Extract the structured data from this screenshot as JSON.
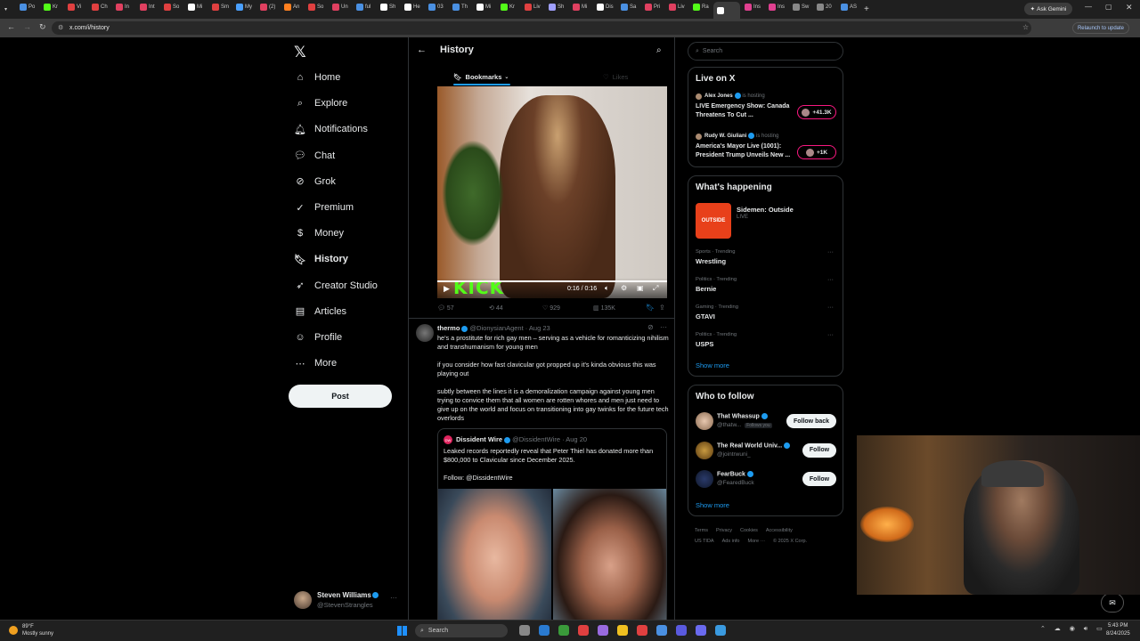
{
  "browser": {
    "tabs": [
      "Po",
      "Kr",
      "Vi",
      "Ch",
      "In",
      "Int",
      "So",
      "Mi",
      "Sm",
      "My",
      "(2)",
      "An",
      "So",
      "Un",
      "ful",
      "Sh",
      "He",
      "03",
      "Th",
      "Mi",
      "Kr",
      "Liv",
      "Sh",
      "Mi",
      "Dis",
      "Sa",
      "Pri",
      "Liv",
      "Ra",
      "",
      "Ins",
      "Ins",
      "Sw",
      "20",
      "AS"
    ],
    "url": "x.com/i/history",
    "ask_gemini": "Ask Gemini",
    "relaunch": "Relaunch to update"
  },
  "nav": {
    "items": [
      {
        "label": "Home",
        "icon": "home-icon"
      },
      {
        "label": "Explore",
        "icon": "search-icon"
      },
      {
        "label": "Notifications",
        "icon": "bell-icon"
      },
      {
        "label": "Chat",
        "icon": "chat-icon"
      },
      {
        "label": "Grok",
        "icon": "grok-icon"
      },
      {
        "label": "Premium",
        "icon": "premium-icon"
      },
      {
        "label": "Money",
        "icon": "money-icon"
      },
      {
        "label": "History",
        "icon": "bookmark-icon"
      },
      {
        "label": "Creator Studio",
        "icon": "rocket-icon"
      },
      {
        "label": "Articles",
        "icon": "articles-icon"
      },
      {
        "label": "Profile",
        "icon": "profile-icon"
      },
      {
        "label": "More",
        "icon": "more-icon"
      }
    ],
    "post_label": "Post"
  },
  "account": {
    "name": "Steven Williams",
    "handle": "@StevenStrangles"
  },
  "center": {
    "title": "History",
    "tabs": [
      {
        "label": "Bookmarks"
      },
      {
        "label": "Likes"
      }
    ],
    "video": {
      "time": "0:16 / 0:16",
      "brand": "KICK"
    },
    "stats": {
      "replies": "57",
      "reposts": "44",
      "likes": "929",
      "views": "135K"
    },
    "post": {
      "name": "thermo",
      "handle": "@DionysianAgent",
      "date": "· Aug 23",
      "text1": "he's a prostitute for rich gay men – serving as a vehicle for romanticizing nihilism and transhumanism for young men",
      "text2": "if you consider how fast clavicular got propped up it's kinda obvious this was playing out",
      "text3": "subtly between the lines it is a demoralization campaign against young men trying to convice them that all women are rotten whores and men just need to give up on the world and focus on transitioning into gay twinks for the future tech overlords"
    },
    "quote": {
      "name": "Dissident Wire",
      "handle": "@DissidentWire",
      "date": "· Aug 20",
      "text": "Leaked records reportedly reveal that Peter Thiel has donated more than $800,000 to Clavicular since December 2025.",
      "follow": "Follow: @DissidentWire"
    }
  },
  "right": {
    "search_placeholder": "Search",
    "live": {
      "title": "Live on X",
      "items": [
        {
          "host": "Alex Jones",
          "status": "is hosting",
          "title": "LIVE Emergency Show: Canada Threatens To Cut ...",
          "count": "+41.3K"
        },
        {
          "host": "Rudy W. Giuliani",
          "status": "is hosting",
          "title": "America's Mayor Live (1001): President Trump Unveils New ...",
          "count": "+1K"
        }
      ]
    },
    "happening": {
      "title": "What's happening",
      "featured": {
        "title": "Sidemen: Outside",
        "status": "LIVE",
        "thumb_text": "OUTSIDE"
      },
      "trends": [
        {
          "context": "Sports · Trending",
          "name": "Wrestling"
        },
        {
          "context": "Politics · Trending",
          "name": "Bernie"
        },
        {
          "context": "Gaming · Trending",
          "name": "GTAVI"
        },
        {
          "context": "Politics · Trending",
          "name": "USPS"
        }
      ],
      "show_more": "Show more"
    },
    "follow": {
      "title": "Who to follow",
      "items": [
        {
          "name": "That Whassup",
          "handle": "@thatw...",
          "badge": "Follows you",
          "button": "Follow back"
        },
        {
          "name": "The Real World Univ...",
          "handle": "@jointrwuni_",
          "button": "Follow"
        },
        {
          "name": "FearBuck",
          "handle": "@FearedBuck",
          "button": "Follow"
        }
      ],
      "show_more": "Show more"
    },
    "footer": {
      "links": [
        "Terms",
        "Privacy",
        "Cookies",
        "Accessibility",
        "US TIDA",
        "Ads info",
        "More ···"
      ],
      "copyright": "© 2025 X Corp."
    }
  },
  "taskbar": {
    "weather_temp": "89°F",
    "weather_desc": "Mostly sunny",
    "search": "Search",
    "time": "5:43 PM",
    "date": "8/24/2025"
  },
  "colors": {
    "accent": "#1d9bf0",
    "border": "#2f3336",
    "muted": "#71767b",
    "live": "#f91880"
  }
}
